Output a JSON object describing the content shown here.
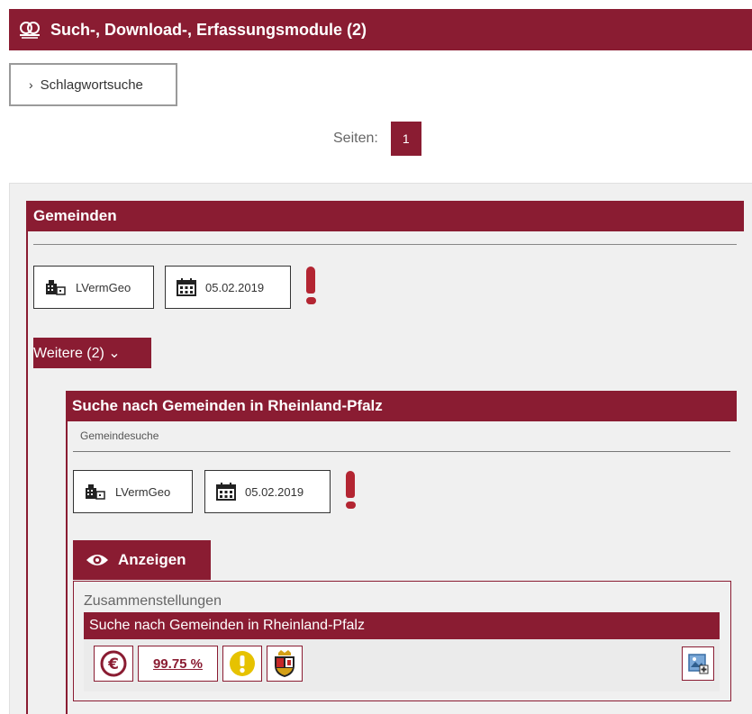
{
  "header": {
    "title": "Such-, Download-, Erfassungsmodule (2)",
    "icon": "search-group-icon"
  },
  "keyword_search": {
    "label": "Schlagwortsuche"
  },
  "pagination": {
    "label": "Seiten:",
    "current": "1"
  },
  "section": {
    "title": "Gemeinden",
    "provider": "LVermGeo",
    "date": "05.02.2019",
    "more_label": "Weitere (2) ⌄"
  },
  "service": {
    "title": "Suche nach Gemeinden in Rheinland-Pfalz",
    "subtitle": "Gemeindesuche",
    "provider": "LVermGeo",
    "date": "05.02.2019",
    "show_label": "Anzeigen",
    "collection_label": "Zusammenstellungen",
    "collection_title": "Suche nach Gemeinden in Rheinland-Pfalz",
    "availability": "99.75 %"
  },
  "colors": {
    "brand": "#8a1c32",
    "warning": "#b32532",
    "info_yellow": "#e6c200"
  }
}
